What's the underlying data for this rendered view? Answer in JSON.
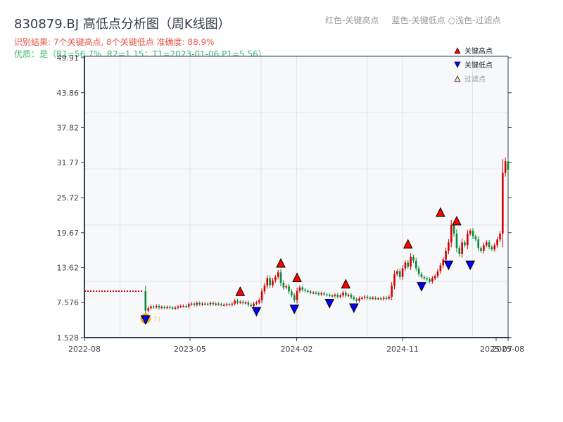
{
  "header": {
    "title": "830879.BJ 高低点分析图（周K线图）",
    "result": "识别结果: 7个关键高点, 8个关键低点  准确度: 88.9%",
    "quality": "优质：是（R1=56.7%, R2=1.15；T1=2023-01-06 P1=5.56）",
    "legend_top": [
      "红色-关键高点",
      "蓝色-关键低点",
      "○浅色-过滤点"
    ]
  },
  "chart_data": {
    "type": "candlestick",
    "title": "830879.BJ 高低点分析图（周K线图）",
    "yticks": [
      "1.528",
      "7.576",
      "13.62",
      "19.67",
      "25.72",
      "31.77",
      "37.82",
      "43.86",
      "49.91"
    ],
    "ylim": [
      1.528,
      49.91
    ],
    "xticks": [
      "2022-08",
      "2023-05",
      "2024-02",
      "2024-11",
      "2025-07",
      "2025-08"
    ],
    "xlim": [
      "2022-08-01",
      "2025-08-01"
    ],
    "grid": true,
    "legend": {
      "placement": "top-right",
      "items": [
        "关键高点",
        "关键低点",
        "过滤点"
      ]
    },
    "colors": {
      "up": "#d40000",
      "down": "#0a8a3a",
      "high": "#ff0000",
      "low": "#0000ff",
      "t1": "#f5a000"
    },
    "pre_period": {
      "from": "2022-08-01",
      "to": "2022-12-30",
      "value": 9.55
    },
    "first_week": "2023-01-06",
    "weekly_close": [
      6.2,
      6.6,
      6.9,
      6.8,
      7.0,
      6.7,
      6.8,
      6.7,
      6.8,
      6.7,
      6.6,
      6.7,
      6.9,
      7.0,
      7.0,
      6.9,
      7.3,
      7.4,
      7.2,
      7.5,
      7.3,
      7.4,
      7.4,
      7.3,
      7.5,
      7.3,
      7.4,
      7.3,
      7.2,
      7.2,
      7.3,
      7.2,
      7.4,
      7.9,
      7.6,
      7.7,
      7.5,
      7.6,
      7.2,
      7.0,
      7.4,
      7.6,
      8.0,
      9.5,
      10.5,
      11.8,
      10.6,
      11.4,
      12.0,
      12.8,
      11.0,
      10.2,
      10.4,
      9.5,
      8.8,
      8.0,
      9.6,
      10.2,
      9.8,
      9.6,
      9.5,
      9.3,
      9.3,
      9.2,
      9.0,
      9.2,
      9.0,
      8.9,
      8.8,
      8.7,
      8.9,
      8.6,
      8.8,
      9.3,
      8.8,
      8.9,
      8.5,
      8.2,
      7.9,
      8.3,
      8.4,
      8.6,
      8.4,
      8.3,
      8.4,
      8.3,
      8.3,
      8.2,
      8.4,
      8.3,
      8.6,
      10.5,
      12.5,
      13.0,
      12.0,
      13.5,
      14.5,
      13.8,
      15.5,
      14.8,
      13.5,
      12.5,
      12.0,
      11.8,
      11.6,
      11.2,
      11.8,
      12.2,
      13.0,
      14.0,
      15.0,
      16.5,
      18.0,
      21.0,
      19.5,
      17.0,
      16.0,
      18.0,
      17.5,
      19.5,
      20.0,
      19.0,
      18.5,
      17.0,
      16.5,
      17.5,
      18.0,
      17.2,
      16.8,
      17.5,
      18.5,
      19.5,
      30.0,
      32.0,
      30.5
    ],
    "key_highs": [
      {
        "date": "2023-09-08",
        "value": 8.3
      },
      {
        "date": "2023-12-22",
        "value": 13.2
      },
      {
        "date": "2024-02-02",
        "value": 10.7
      },
      {
        "date": "2024-06-07",
        "value": 9.6
      },
      {
        "date": "2024-11-15",
        "value": 16.5
      },
      {
        "date": "2025-02-07",
        "value": 22.0
      },
      {
        "date": "2025-03-21",
        "value": 20.5
      }
    ],
    "key_lows": [
      {
        "date": "2023-01-06",
        "value": 5.56
      },
      {
        "date": "2023-10-20",
        "value": 7.0
      },
      {
        "date": "2024-01-26",
        "value": 7.4
      },
      {
        "date": "2024-04-26",
        "value": 8.4
      },
      {
        "date": "2024-06-28",
        "value": 7.6
      },
      {
        "date": "2024-12-20",
        "value": 11.3
      },
      {
        "date": "2025-02-28",
        "value": 15.0
      },
      {
        "date": "2025-04-25",
        "value": 15.0
      }
    ],
    "t1_label": "T1"
  }
}
